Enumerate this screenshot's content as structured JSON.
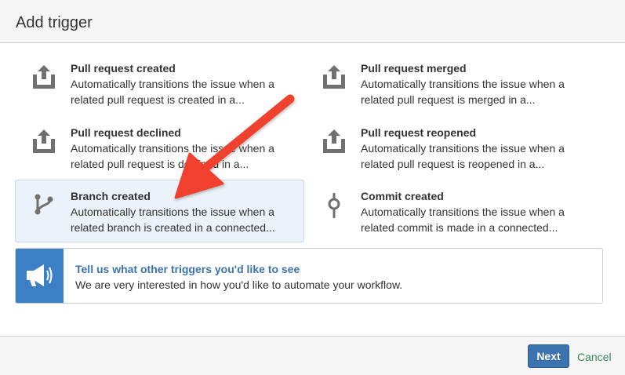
{
  "dialog": {
    "title": "Add trigger"
  },
  "triggers": [
    {
      "title": "Pull request created",
      "desc": "Automatically transitions the issue when a related pull request is created in a...",
      "icon": "share-upload-icon"
    },
    {
      "title": "Pull request merged",
      "desc": "Automatically transitions the issue when a related pull request is merged in a...",
      "icon": "share-upload-icon"
    },
    {
      "title": "Pull request declined",
      "desc": "Automatically transitions the issue when a related pull request is declined in a...",
      "icon": "share-upload-icon"
    },
    {
      "title": "Pull request reopened",
      "desc": "Automatically transitions the issue when a related pull request is reopened in a...",
      "icon": "share-upload-icon"
    },
    {
      "title": "Branch created",
      "desc": "Automatically transitions the issue when a related branch is created in a connected...",
      "icon": "branch-icon",
      "selected": true
    },
    {
      "title": "Commit created",
      "desc": "Automatically transitions the issue when a related commit is made in a connected...",
      "icon": "commit-icon"
    }
  ],
  "feedback": {
    "link_text": "Tell us what other triggers you'd like to see",
    "text": "We are very interested in how you'd like to automate your workflow.",
    "icon": "megaphone-icon"
  },
  "footer": {
    "next_label": "Next",
    "cancel_label": "Cancel"
  },
  "colors": {
    "primary": "#3b73af",
    "selected_bg": "#ebf2f9",
    "feedback_icon_bg": "#3b7fc4",
    "annotation_arrow": "#f0402f",
    "icon_gray": "#707070"
  }
}
